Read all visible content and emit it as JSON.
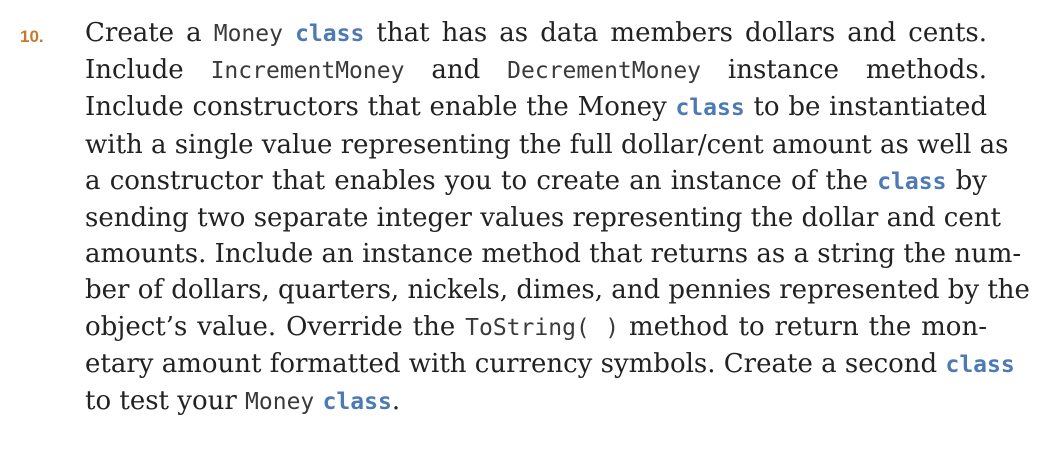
{
  "exercise": {
    "number": "10.",
    "lines": [
      [
        {
          "t": "text",
          "v": "Create a "
        },
        {
          "t": "code",
          "v": "Money"
        },
        {
          "t": "text",
          "v": " "
        },
        {
          "t": "kw",
          "v": "class"
        },
        {
          "t": "text",
          "v": " that has as data members dollars and cents."
        }
      ],
      [
        {
          "t": "text",
          "v": "Include "
        },
        {
          "t": "code",
          "v": "IncrementMoney"
        },
        {
          "t": "text",
          "v": " and "
        },
        {
          "t": "code",
          "v": "DecrementMoney"
        },
        {
          "t": "text",
          "v": " instance methods."
        }
      ],
      [
        {
          "t": "text",
          "v": "Include constructors that enable the Money "
        },
        {
          "t": "kw",
          "v": "class"
        },
        {
          "t": "text",
          "v": " to be instantiated"
        }
      ],
      [
        {
          "t": "text",
          "v": "with a single value representing the full dollar/cent amount as well as"
        }
      ],
      [
        {
          "t": "text",
          "v": "a constructor that enables you to create an instance of the "
        },
        {
          "t": "kw",
          "v": "class"
        },
        {
          "t": "text",
          "v": " by"
        }
      ],
      [
        {
          "t": "text",
          "v": "sending two separate integer values representing the dollar and cent"
        }
      ],
      [
        {
          "t": "text",
          "v": "amounts. Include an instance method that returns as a string the num-"
        }
      ],
      [
        {
          "t": "text",
          "v": "ber of dollars, quarters, nickels, dimes, and pennies represented by the"
        }
      ],
      [
        {
          "t": "text",
          "v": "object’s value. Override the "
        },
        {
          "t": "code",
          "v": "ToString( )"
        },
        {
          "t": "text",
          "v": " method to return the mon-"
        }
      ],
      [
        {
          "t": "text",
          "v": "etary amount formatted with currency symbols. Create a second "
        },
        {
          "t": "kw",
          "v": "class"
        }
      ],
      [
        {
          "t": "text",
          "v": "to test your "
        },
        {
          "t": "code",
          "v": "Money"
        },
        {
          "t": "text",
          "v": " "
        },
        {
          "t": "kw",
          "v": "class"
        },
        {
          "t": "text",
          "v": "."
        }
      ]
    ]
  },
  "colors": {
    "number": "#c7782a",
    "keyword": "#4d7ab5",
    "text": "#222222"
  }
}
